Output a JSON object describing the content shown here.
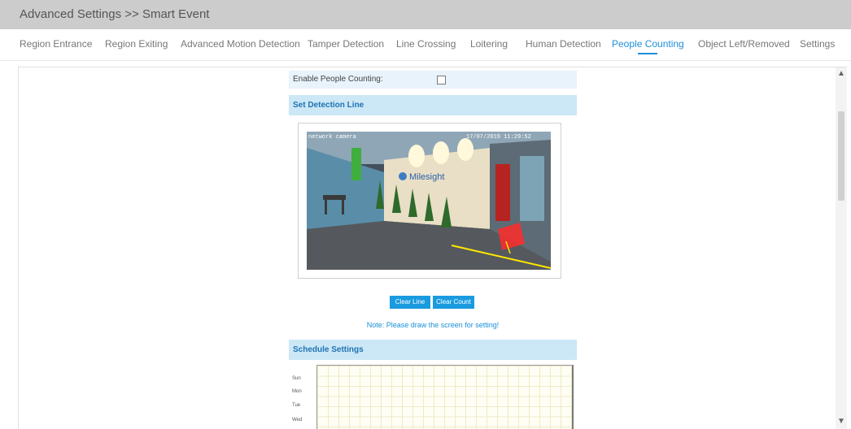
{
  "header": {
    "title": "Advanced Settings >> Smart Event"
  },
  "tabs": [
    {
      "label": "Region Entrance",
      "active": false
    },
    {
      "label": "Region Exiting",
      "active": false
    },
    {
      "label": "Advanced Motion Detection",
      "active": false
    },
    {
      "label": "Tamper Detection",
      "active": false
    },
    {
      "label": "Line Crossing",
      "active": false
    },
    {
      "label": "Loitering",
      "active": false
    },
    {
      "label": "Human Detection",
      "active": false
    },
    {
      "label": "People Counting",
      "active": true
    },
    {
      "label": "Object Left/Removed",
      "active": false
    },
    {
      "label": "Settings",
      "active": false
    }
  ],
  "form": {
    "enable_label": "Enable People Counting:",
    "enable_checked": false,
    "detection_section": "Set Detection Line",
    "clear_line_label": "Clear Line",
    "clear_count_label": "Clear Count",
    "note": "Note: Please draw the screen for setting!",
    "schedule_section": "Schedule Settings"
  },
  "video": {
    "osd_name": "network camera",
    "osd_datetime": "17/07/2019 11:29:52",
    "brand_text": "Milesight"
  },
  "schedule": {
    "days": [
      "Sun",
      "Mon",
      "Tue",
      "Wed"
    ]
  },
  "colors": {
    "accent": "#1f8fd8",
    "button": "#1a9be0",
    "section_bg": "#cce7f6",
    "row_bg": "#e8f3fb"
  },
  "icons": {
    "scroll_up": "▲",
    "scroll_down": "▼"
  }
}
